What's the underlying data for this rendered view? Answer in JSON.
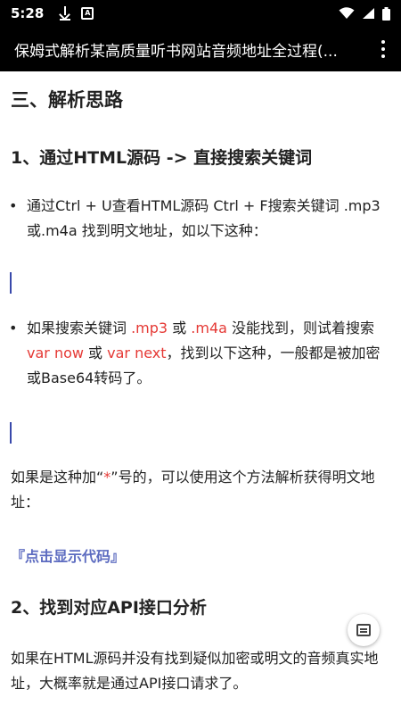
{
  "status": {
    "time": "5:28",
    "icons": [
      "download-icon",
      "a-badge-icon",
      "wifi-icon",
      "signal-icon",
      "battery-icon"
    ]
  },
  "app_bar": {
    "title": "保姆式解析某高质量听书网站音频地址全过程(..."
  },
  "article": {
    "section_title": "三、解析思路",
    "step1_title": "1、通过HTML源码 -> 直接搜索关键词",
    "bullet1": "通过Ctrl + U查看HTML源码 Ctrl + F搜索关键词 .mp3或.m4a 找到明文地址，如以下这种：",
    "bullet2": {
      "t1": "如果搜索关键词 ",
      "k1": ".mp3",
      "t2": " 或 ",
      "k2": ".m4a",
      "t3": " 没能找到，则试着搜索 ",
      "k3": "var now",
      "t4": " 或 ",
      "k4": "var next",
      "t5": "，找到以下这种，一般都是被加密或Base64转码了。"
    },
    "para1": {
      "t1": "如果是这种加“",
      "star": "*",
      "t2": "”号的，可以使用这个方法解析获得明文地址："
    },
    "show_code_link": "『点击显示代码』",
    "step2_title": "2、找到对应API接口分析",
    "para2": "如果在HTML源码并没有找到疑似加密或明文的音频真实地址，大概率就是通过API接口请求了。"
  },
  "colors": {
    "keyword": "#e53935",
    "link": "#5c6bc0",
    "cursor": "#3949ab"
  }
}
